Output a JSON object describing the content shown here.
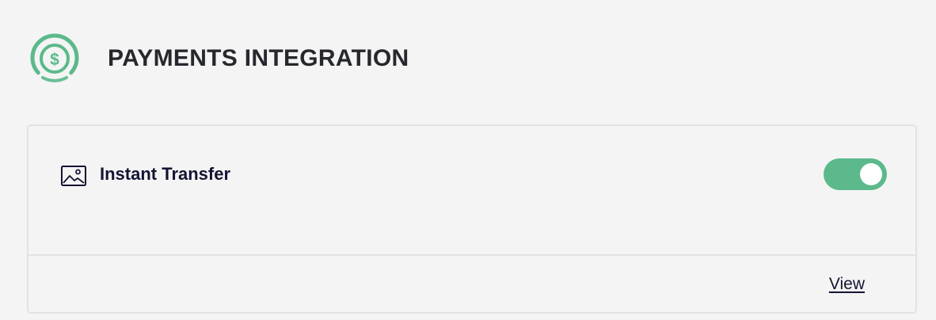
{
  "header": {
    "icon": "dollar-circle-icon",
    "title": "PAYMENTS INTEGRATION",
    "accent_color": "#5bb98b"
  },
  "integration_card": {
    "icon": "image-icon",
    "title": "Instant Transfer",
    "toggle_enabled": true,
    "toggle_color": "#5bb98b",
    "link_label": "View"
  }
}
